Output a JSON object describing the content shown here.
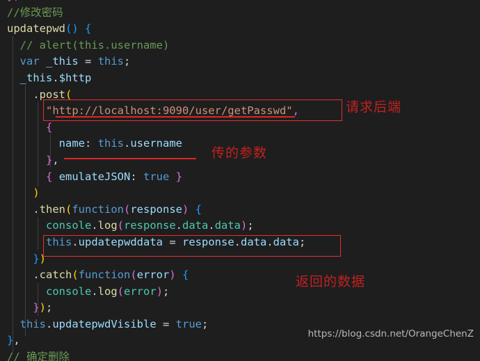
{
  "editor": {
    "background": "#1e1e1e",
    "foreground": "#d4d4d4",
    "language": "javascript"
  },
  "code_lines": [
    {
      "id": "l0",
      "text": "})"
    },
    {
      "id": "l1",
      "text": "//修改密码"
    },
    {
      "id": "l2",
      "text": "updatepwd() {"
    },
    {
      "id": "l3",
      "text": "  // alert(this.username)"
    },
    {
      "id": "l4",
      "text": "  var _this = this;"
    },
    {
      "id": "l5",
      "text": "  _this.$http"
    },
    {
      "id": "l6",
      "text": "    .post("
    },
    {
      "id": "l7",
      "text": "      \"http://localhost:9090/user/getPasswd\","
    },
    {
      "id": "l8",
      "text": "      {"
    },
    {
      "id": "l9",
      "text": "        name: this.username"
    },
    {
      "id": "l10",
      "text": "      },"
    },
    {
      "id": "l11",
      "text": "      { emulateJSON: true }"
    },
    {
      "id": "l12",
      "text": "    )"
    },
    {
      "id": "l13",
      "text": "    .then(function(response) {"
    },
    {
      "id": "l14",
      "text": "      console.log(response.data.data);"
    },
    {
      "id": "l15",
      "text": "      this.updatepwddata = response.data.data;"
    },
    {
      "id": "l16",
      "text": "    })"
    },
    {
      "id": "l17",
      "text": "    .catch(function(error) {"
    },
    {
      "id": "l18",
      "text": "      console.log(error);"
    },
    {
      "id": "l19",
      "text": "    });"
    },
    {
      "id": "l20",
      "text": "  this.updatepwdVisible = true;"
    },
    {
      "id": "l21",
      "text": "},"
    },
    {
      "id": "l22",
      "text": "// 确定删除"
    }
  ],
  "annotations": {
    "box_url_label": "请求后端",
    "underline_param_label": "传的参数",
    "box_response_label": "返回的数据",
    "color": "#c42020",
    "box_color": "#e83030"
  },
  "watermark": {
    "text": "https://blog.csdn.net/OrangeChenZ"
  },
  "tokens": {
    "l0": [
      [
        "b2",
        "})"
      ]
    ],
    "l1": [
      [
        "cmt",
        "//修改密码"
      ]
    ],
    "l2": [
      [
        "fn",
        "updatepwd"
      ],
      [
        "b3",
        "()"
      ],
      [
        "plain",
        " "
      ],
      [
        "b3",
        "{"
      ]
    ],
    "l3": [
      [
        "plain",
        "  "
      ],
      [
        "cmt",
        "// alert(this.username)"
      ]
    ],
    "l4": [
      [
        "plain",
        "  "
      ],
      [
        "kw",
        "var"
      ],
      [
        "plain",
        " "
      ],
      [
        "var",
        "_this"
      ],
      [
        "plain",
        " = "
      ],
      [
        "kw",
        "this"
      ],
      [
        "plain",
        ";"
      ]
    ],
    "l5": [
      [
        "plain",
        "  "
      ],
      [
        "var",
        "_this"
      ],
      [
        "plain",
        "."
      ],
      [
        "var",
        "$http"
      ]
    ],
    "l6": [
      [
        "plain",
        "    ."
      ],
      [
        "fn",
        "post"
      ],
      [
        "b1",
        "("
      ]
    ],
    "l7": [
      [
        "plain",
        "      "
      ],
      [
        "str",
        "\"http://localhost:9090/user/getPasswd\""
      ],
      [
        "b2",
        ","
      ]
    ],
    "l8": [
      [
        "plain",
        "      "
      ],
      [
        "b2",
        "{"
      ]
    ],
    "l9": [
      [
        "plain",
        "        "
      ],
      [
        "var",
        "name"
      ],
      [
        "plain",
        ": "
      ],
      [
        "kw",
        "this"
      ],
      [
        "plain",
        "."
      ],
      [
        "var",
        "username"
      ]
    ],
    "l10": [
      [
        "plain",
        "      "
      ],
      [
        "b2",
        "}"
      ],
      [
        "plain",
        ","
      ]
    ],
    "l11": [
      [
        "plain",
        "      "
      ],
      [
        "b2",
        "{"
      ],
      [
        "plain",
        " "
      ],
      [
        "var",
        "emulateJSON"
      ],
      [
        "plain",
        ": "
      ],
      [
        "kw",
        "true"
      ],
      [
        "plain",
        " "
      ],
      [
        "b2",
        "}"
      ]
    ],
    "l12": [
      [
        "plain",
        "    "
      ],
      [
        "b1",
        ")"
      ]
    ],
    "l13": [
      [
        "plain",
        "    ."
      ],
      [
        "fn",
        "then"
      ],
      [
        "b1",
        "("
      ],
      [
        "kw",
        "function"
      ],
      [
        "b2",
        "("
      ],
      [
        "var",
        "response"
      ],
      [
        "b2",
        ")"
      ],
      [
        "plain",
        " "
      ],
      [
        "b3",
        "{"
      ]
    ],
    "l14": [
      [
        "plain",
        "      "
      ],
      [
        "teal",
        "console"
      ],
      [
        "plain",
        "."
      ],
      [
        "fn",
        "log"
      ],
      [
        "b2",
        "("
      ],
      [
        "teal",
        "response"
      ],
      [
        "plain",
        "."
      ],
      [
        "teal",
        "data"
      ],
      [
        "plain",
        "."
      ],
      [
        "teal",
        "data"
      ],
      [
        "b2",
        ")"
      ],
      [
        "plain",
        ";"
      ]
    ],
    "l15": [
      [
        "plain",
        "      "
      ],
      [
        "kw",
        "this"
      ],
      [
        "plain",
        "."
      ],
      [
        "var",
        "updatepwddata"
      ],
      [
        "plain",
        " = "
      ],
      [
        "var",
        "response"
      ],
      [
        "plain",
        "."
      ],
      [
        "var",
        "data"
      ],
      [
        "plain",
        "."
      ],
      [
        "var",
        "data"
      ],
      [
        "plain",
        ";"
      ]
    ],
    "l16": [
      [
        "plain",
        "    "
      ],
      [
        "b3",
        "}"
      ],
      [
        "b1",
        ")"
      ]
    ],
    "l17": [
      [
        "plain",
        "    ."
      ],
      [
        "fn",
        "catch"
      ],
      [
        "b1",
        "("
      ],
      [
        "kw",
        "function"
      ],
      [
        "b2",
        "("
      ],
      [
        "var",
        "error"
      ],
      [
        "b2",
        ")"
      ],
      [
        "plain",
        " "
      ],
      [
        "b3",
        "{"
      ]
    ],
    "l18": [
      [
        "plain",
        "      "
      ],
      [
        "teal",
        "console"
      ],
      [
        "plain",
        "."
      ],
      [
        "fn",
        "log"
      ],
      [
        "b2",
        "("
      ],
      [
        "teal",
        "error"
      ],
      [
        "b2",
        ")"
      ],
      [
        "plain",
        ";"
      ]
    ],
    "l19": [
      [
        "plain",
        "    "
      ],
      [
        "b2",
        "}"
      ],
      [
        "b1",
        ")"
      ],
      [
        "plain",
        ";"
      ]
    ],
    "l20": [
      [
        "plain",
        "  "
      ],
      [
        "kw",
        "this"
      ],
      [
        "plain",
        "."
      ],
      [
        "var",
        "updatepwdVisible"
      ],
      [
        "plain",
        " = "
      ],
      [
        "kw",
        "true"
      ],
      [
        "plain",
        ";"
      ]
    ],
    "l21": [
      [
        "b3",
        "}"
      ],
      [
        "plain",
        ","
      ]
    ],
    "l22": [
      [
        "cmt",
        "// 确定删除"
      ]
    ]
  }
}
